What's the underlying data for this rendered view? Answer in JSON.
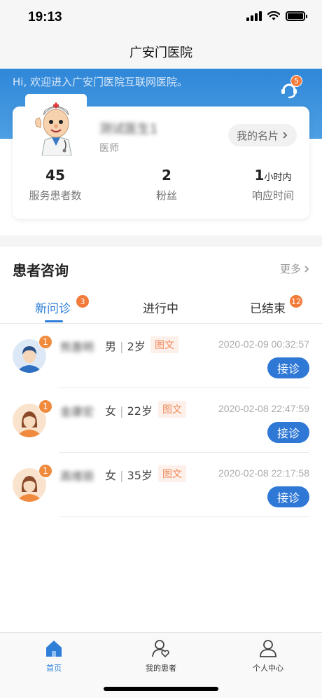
{
  "status_bar": {
    "time": "19:13"
  },
  "nav": {
    "title": "广安门医院"
  },
  "header": {
    "welcome": "Hi, 欢迎进入广安门医院互联网医院。",
    "service_badge": "5"
  },
  "doctor": {
    "name": "测试医生1",
    "title": "医师",
    "card_button": "我的名片",
    "stats": [
      {
        "value": "45",
        "unit": "",
        "label": "服务患者数"
      },
      {
        "value": "2",
        "unit": "",
        "label": "粉丝"
      },
      {
        "value": "1",
        "unit": "小时内",
        "label": "响应时间"
      }
    ]
  },
  "consult": {
    "title": "患者咨询",
    "more": "更多",
    "tabs": [
      {
        "label": "新问诊",
        "badge": "3"
      },
      {
        "label": "进行中",
        "badge": ""
      },
      {
        "label": "已结束",
        "badge": "12"
      }
    ],
    "patients": [
      {
        "name": "熊惠明",
        "gender": "男",
        "age": "2岁",
        "type": "图文",
        "time": "2020-02-09 00:32:57",
        "badge": "1",
        "action": "接诊"
      },
      {
        "name": "金康宏",
        "gender": "女",
        "age": "22岁",
        "type": "图文",
        "time": "2020-02-08 22:47:59",
        "badge": "1",
        "action": "接诊"
      },
      {
        "name": "高维丽",
        "gender": "女",
        "age": "35岁",
        "type": "图文",
        "time": "2020-02-08 22:17:58",
        "badge": "1",
        "action": "接诊"
      }
    ]
  },
  "bottom_nav": [
    {
      "label": "首页",
      "icon": "home-icon"
    },
    {
      "label": "我的患者",
      "icon": "patients-icon"
    },
    {
      "label": "个人中心",
      "icon": "profile-icon"
    }
  ],
  "colors": {
    "primary": "#2f7fd8",
    "badge": "#f27b3a",
    "tag_bg": "#fdf0ea",
    "tag_text": "#f08a5a"
  }
}
